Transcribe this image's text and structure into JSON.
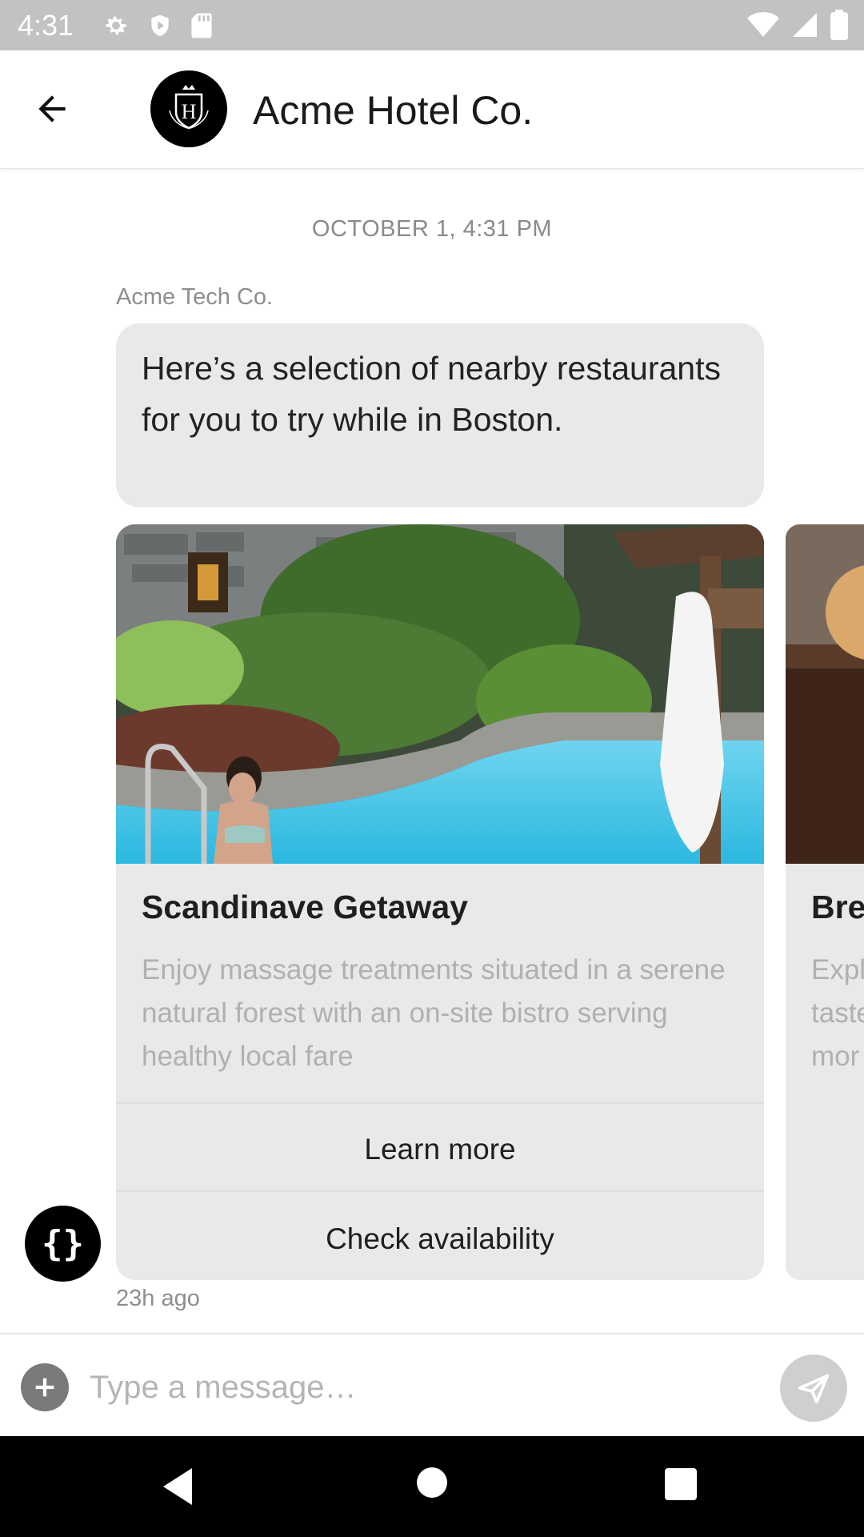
{
  "status_bar": {
    "time": "4:31",
    "left_icons": [
      "gear-icon",
      "shield-icon",
      "sd-card-icon"
    ],
    "right_icons": [
      "wifi-icon",
      "signal-icon",
      "battery-icon"
    ]
  },
  "header": {
    "title": "Acme Hotel Co.",
    "avatar_letter": "H"
  },
  "conversation": {
    "timestamp": "OCTOBER 1, 4:31 PM",
    "sender": "Acme Tech Co.",
    "message": "Here’s a selection of nearby restaurants for you to try while in Boston.",
    "relative_time": "23h ago",
    "bot_avatar_text": "{}"
  },
  "cards": [
    {
      "title": "Scandinave Getaway",
      "description": "Enjoy massage treatments situated in a serene natural forest with an on-site bistro serving healthy local fare",
      "actions": [
        "Learn more",
        "Check availability"
      ]
    }
  ],
  "peek_card": {
    "title": "Bre",
    "description_lines": [
      "Expl",
      "taste",
      "mor"
    ]
  },
  "composer": {
    "placeholder": "Type a message…"
  },
  "colors": {
    "status_bar": "#c2c2c2",
    "bubble": "#e9e9e9",
    "pool_water": "#3fc3e6",
    "nav_bar": "#000000"
  }
}
